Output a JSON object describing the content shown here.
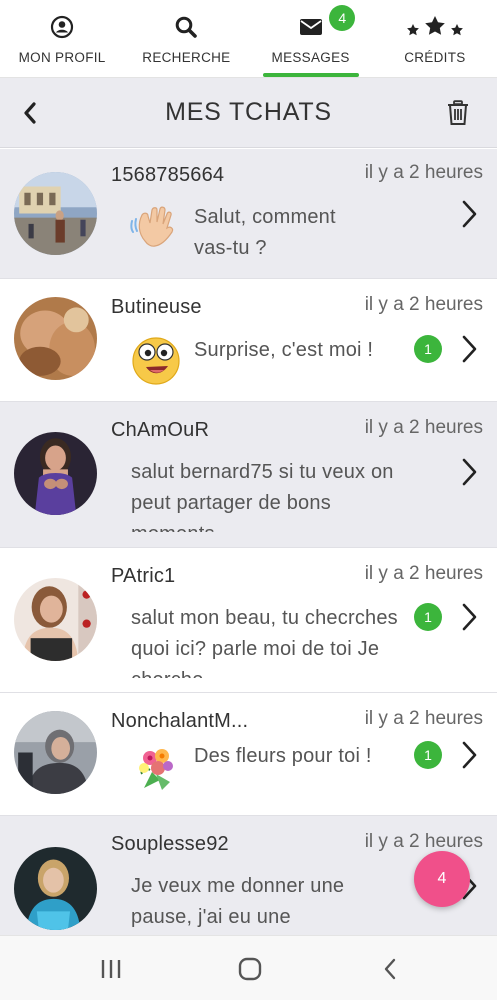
{
  "nav": {
    "items": [
      {
        "label": "MON PROFIL",
        "icon": "user-circle-icon"
      },
      {
        "label": "RECHERCHE",
        "icon": "search-icon"
      },
      {
        "label": "MESSAGES",
        "icon": "envelope-icon",
        "badge": "4",
        "active": true
      },
      {
        "label": "CRÉDITS",
        "icon": "stars-icon"
      }
    ],
    "accent_color": "#3cb53c"
  },
  "header": {
    "title": "MES TCHATS",
    "back_icon": "chevron-left-icon",
    "trash_icon": "trash-icon"
  },
  "chats": [
    {
      "name": "1568785664",
      "time": "il y a 2 heures",
      "message": "Salut, comment vas-tu ?",
      "emoji": "waving-hand",
      "unread": null
    },
    {
      "name": "Butineuse",
      "time": "il y a 2 heures",
      "message": "Surprise, c'est moi !",
      "emoji": "surprised-face",
      "unread": "1"
    },
    {
      "name": "ChAmOuR",
      "time": "il y a 2 heures",
      "message": "salut bernard75 si tu veux on peut partager de bons moments",
      "emoji": null,
      "unread": null
    },
    {
      "name": "PAtric1",
      "time": "il y a 2 heures",
      "message": "salut mon beau, tu checrches quoi ici? parle moi de toi Je cherche",
      "emoji": null,
      "unread": "1"
    },
    {
      "name": "NonchalantM...",
      "time": "il y a 2 heures",
      "message": "Des fleurs pour toi !",
      "emoji": "bouquet",
      "unread": "1"
    },
    {
      "name": "Souplesse92",
      "time": "il y a 2 heures",
      "message": "Je veux me donner une pause, j'ai eu une",
      "emoji": null,
      "unread": null
    }
  ],
  "fab": {
    "count": "4",
    "color": "#f0508a"
  },
  "system_nav": [
    "recent-apps-icon",
    "home-icon",
    "back-icon"
  ]
}
